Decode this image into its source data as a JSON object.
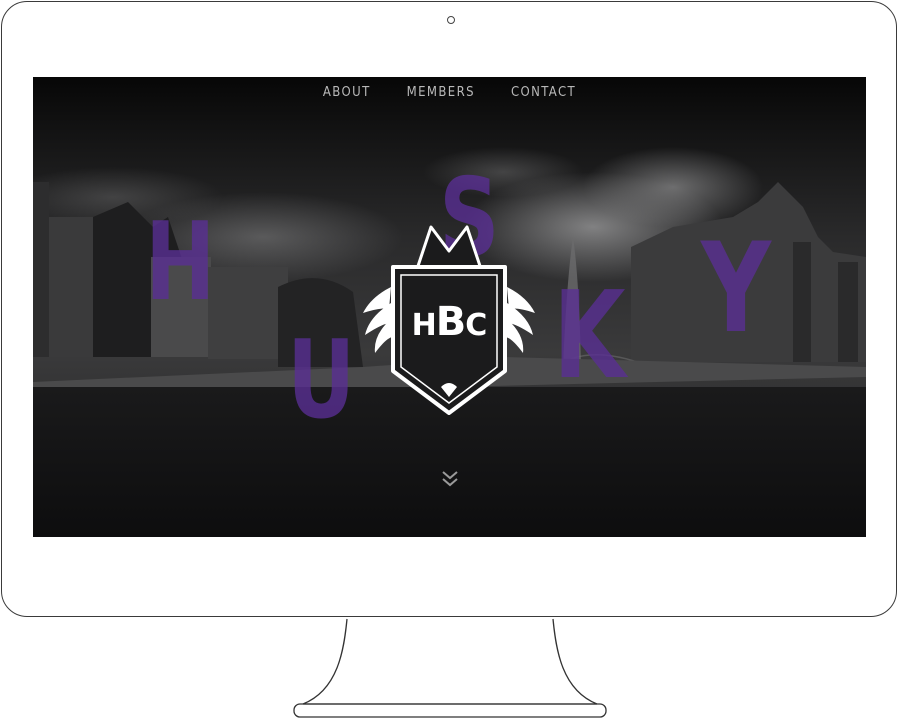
{
  "nav": {
    "items": [
      {
        "label": "ABOUT"
      },
      {
        "label": "MEMBERS"
      },
      {
        "label": "CONTACT"
      }
    ]
  },
  "hero": {
    "letters": [
      "H",
      "U",
      "S",
      "K",
      "Y"
    ],
    "logo": {
      "pre": "H",
      "mid": "B",
      "post": "C"
    },
    "scroll_icon": "double-chevron-down-icon"
  },
  "colors": {
    "accent": "#5a2f95",
    "screen_bg": "#0b0b0c",
    "nav_text": "#b9b9b9",
    "frame": "#3a3a3a"
  }
}
